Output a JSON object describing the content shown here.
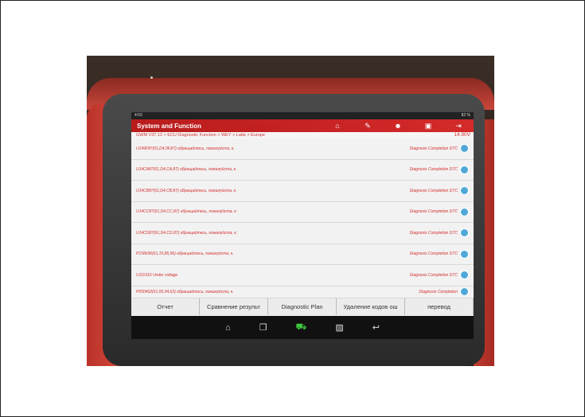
{
  "status": {
    "time": "4:03",
    "battery": "82 %"
  },
  "header": {
    "title": "System and Function"
  },
  "toolbar_icons": [
    "home-icon",
    "edit-icon",
    "user-icon",
    "print-icon",
    "exit-icon"
  ],
  "breadcrumb": "GWM V37.12 > ECU Diagnostic Function > WEY > Latte > Europe",
  "voltage": "14.90V",
  "rows": [
    {
      "code": "U149F87(61,D4,9F,87) обращайтесь, пожалуйста, к.",
      "status": "Diagnosis Completion DTC"
    },
    {
      "code": "U14CA87(61,D4,CA,87) обращайтесь, пожалуйста, к.",
      "status": "Diagnosis Completion DTC"
    },
    {
      "code": "U14CB87(61,D4,CB,87) обращайтесь, пожалуйста, к.",
      "status": "Diagnosis Completion DTC"
    },
    {
      "code": "U14CC87(61,D4,CC,87) обращайтесь, пожалуйста, к.",
      "status": "Diagnosis Completion DTC"
    },
    {
      "code": "U14CD87(61,D4,CD,87) обращайтесь, пожалуйста, к.",
      "status": "Diagnosis Completion DTC"
    },
    {
      "code": "P158696(61,15,86,96) обращайтесь, пожалуйста, к.",
      "status": "Diagnosis Completion DTC"
    },
    {
      "code": "U110116 Under voltage",
      "status": "Diagnosis Completion DTC"
    },
    {
      "code": "P050462(61,05,04,62) обращайтесь, пожалуйста, к.",
      "status": "Diagnosis Completion"
    }
  ],
  "buttons": [
    "Отчет",
    "Сравнение результ",
    "Diagnostic Plan",
    "Удаление кодов ош",
    "перевод"
  ],
  "nav_icons": [
    "home-icon",
    "recent-apps-icon",
    "car-icon",
    "gallery-icon",
    "back-icon"
  ]
}
